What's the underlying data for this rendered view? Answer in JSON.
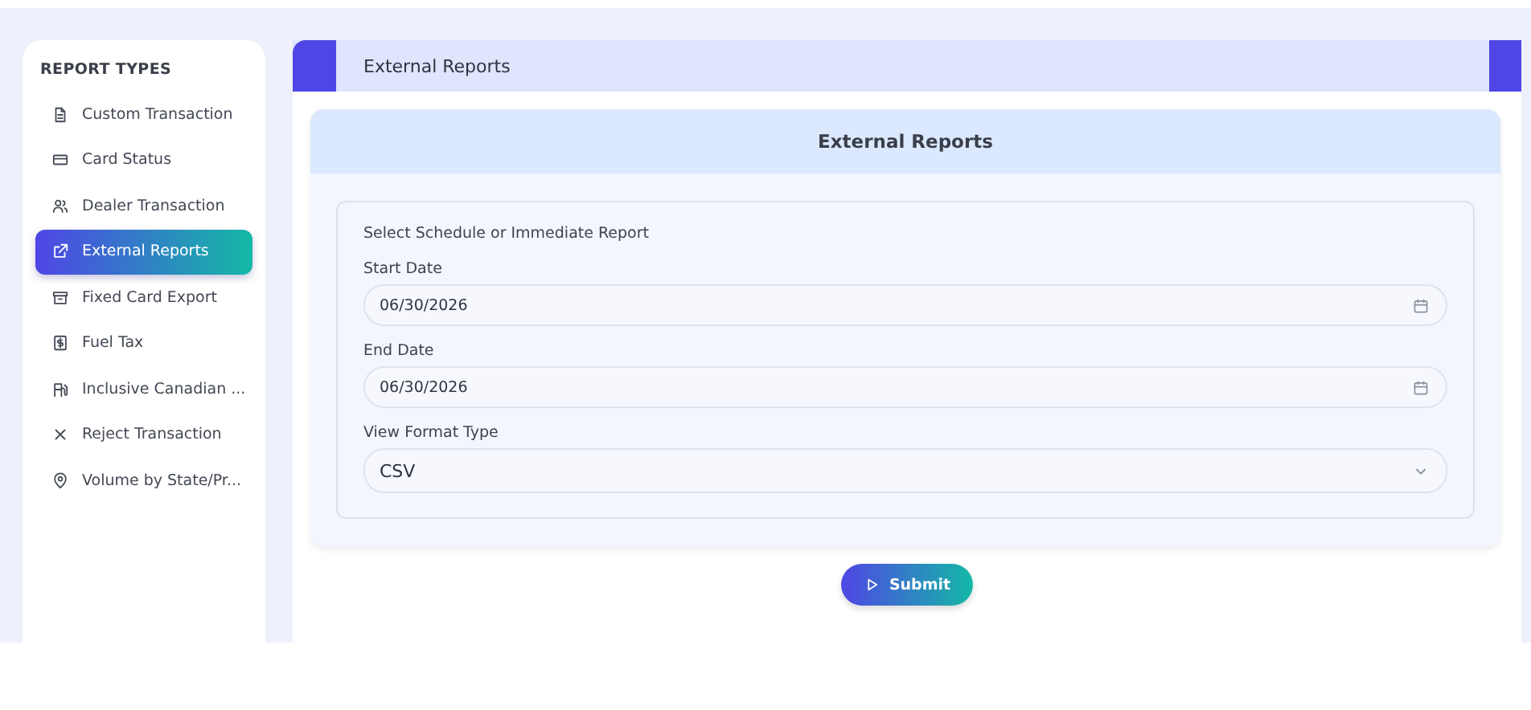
{
  "sidebar": {
    "heading": "REPORT TYPES",
    "items": [
      {
        "label": "Custom Transaction",
        "selected": false
      },
      {
        "label": "Card Status",
        "selected": false
      },
      {
        "label": "Dealer Transaction",
        "selected": false
      },
      {
        "label": "External Reports",
        "selected": true
      },
      {
        "label": "Fixed Card Export",
        "selected": false
      },
      {
        "label": "Fuel Tax",
        "selected": false
      },
      {
        "label": "Inclusive Canadian ...",
        "selected": false
      },
      {
        "label": "Reject Transaction",
        "selected": false
      },
      {
        "label": "Volume by State/Pr...",
        "selected": false
      }
    ]
  },
  "header": {
    "title": "External Reports"
  },
  "panel": {
    "title": "External Reports",
    "intro": "Select Schedule or Immediate Report",
    "fields": [
      {
        "kind": "date",
        "label": "Start Date",
        "value": "06/30/2026"
      },
      {
        "kind": "date",
        "label": "End Date",
        "value": "06/30/2026"
      },
      {
        "kind": "select",
        "label": "View Format Type",
        "value": "CSV"
      }
    ]
  },
  "submit": {
    "label": "Submit"
  }
}
